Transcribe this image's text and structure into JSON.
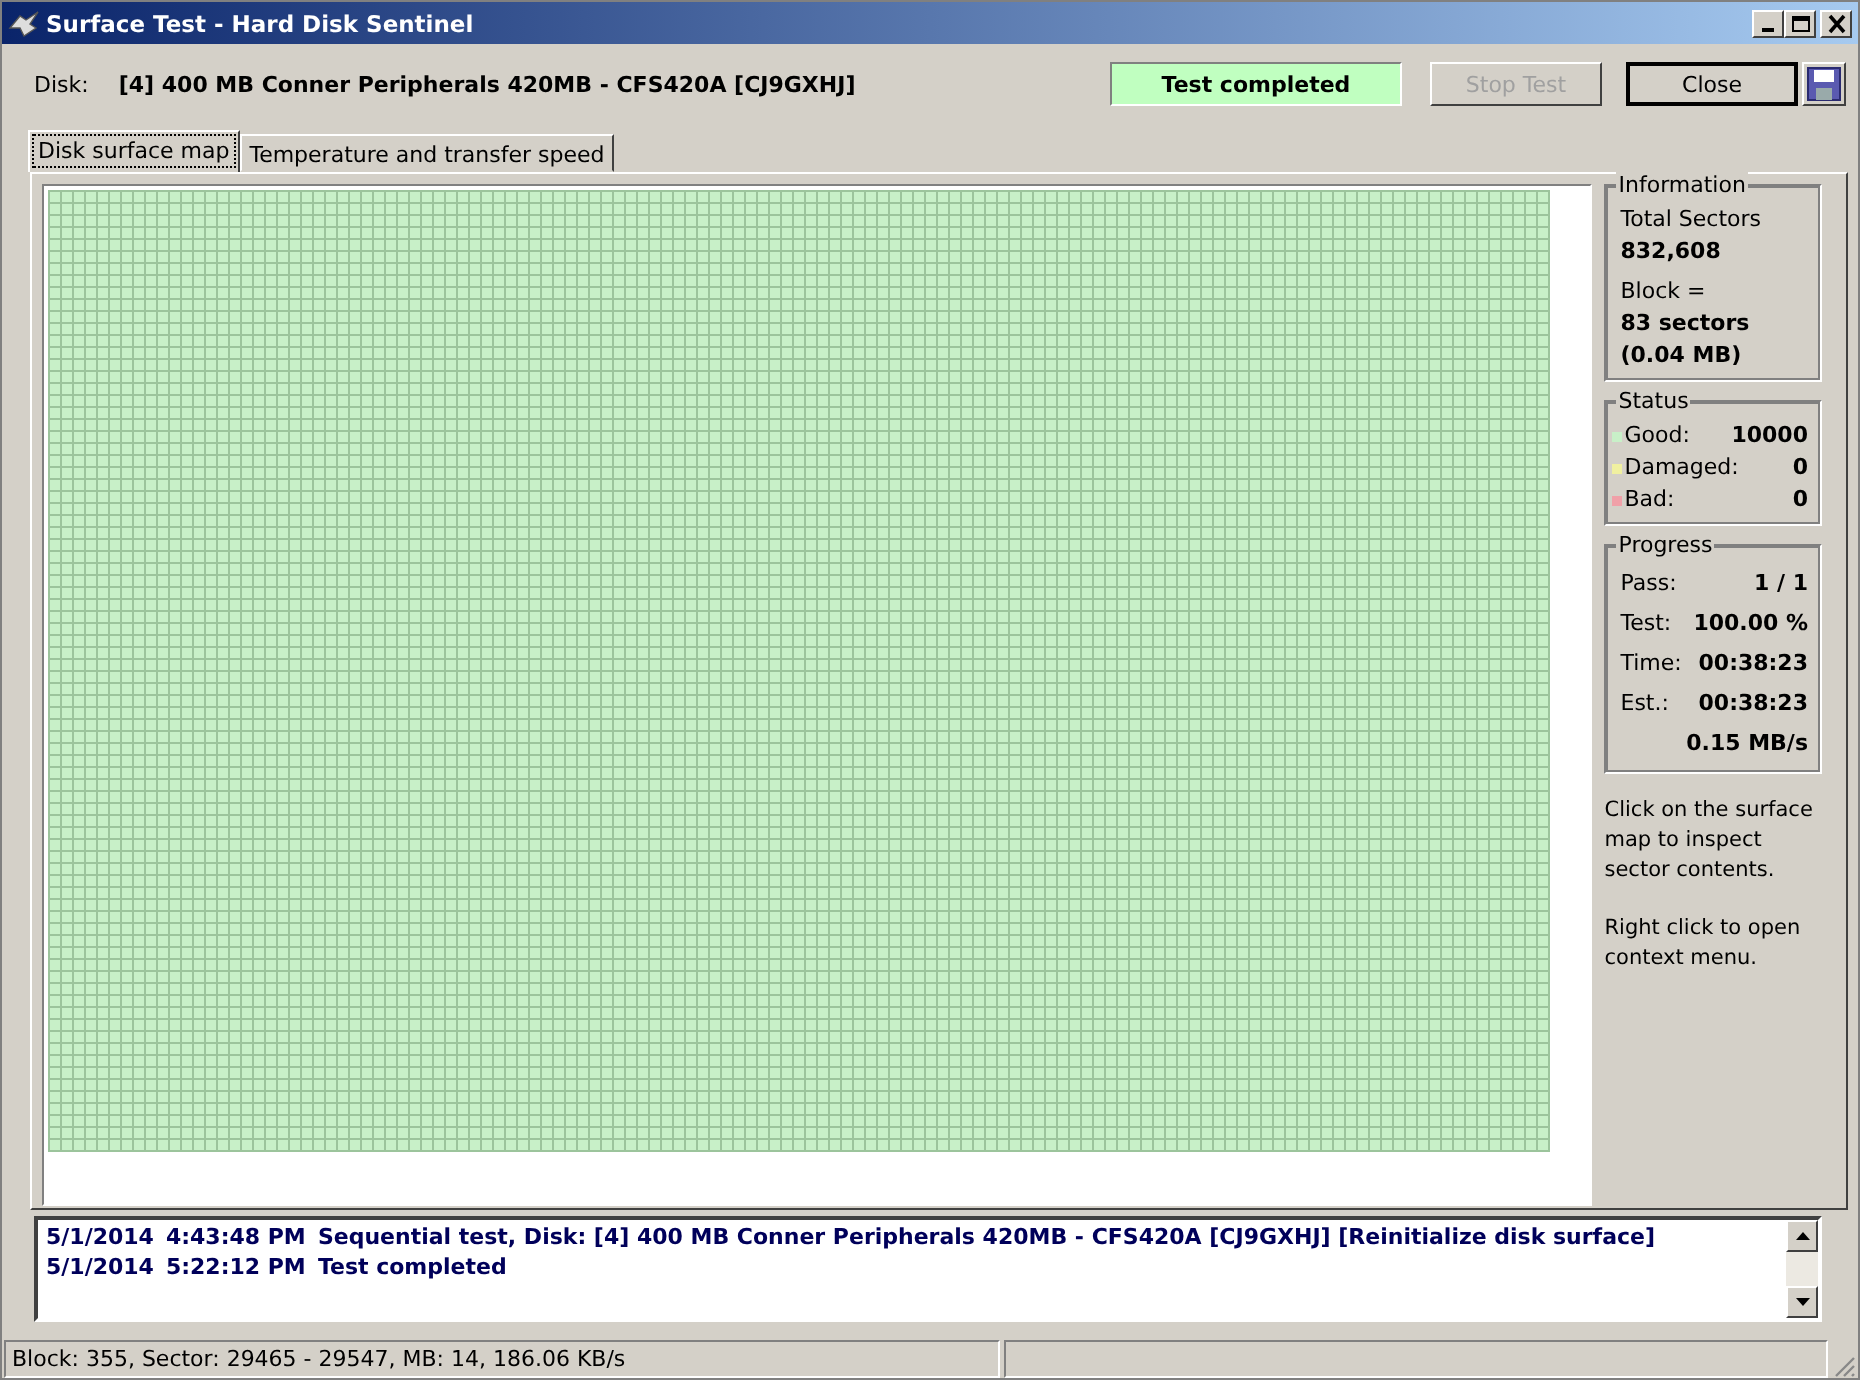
{
  "window": {
    "title": "Surface Test - Hard Disk Sentinel"
  },
  "toolbar": {
    "disk_label": "Disk:",
    "disk_name": "[4] 400 MB  Conner Peripherals 420MB - CFS420A [CJ9GXHJ]",
    "status_text": "Test completed",
    "buttons": [
      {
        "label": "Stop Test",
        "disabled": true
      },
      {
        "label": "Close",
        "disabled": false
      }
    ]
  },
  "tabs": [
    {
      "label": "Disk surface map",
      "selected": true
    },
    {
      "label": "Temperature and transfer speed",
      "selected": false
    }
  ],
  "information": {
    "title": "Information",
    "total_label": "Total Sectors",
    "total_value": "832,608",
    "block_label": "Block =",
    "block_sectors": "83 sectors",
    "block_size": "(0.04 MB)"
  },
  "status": {
    "title": "Status",
    "items": [
      {
        "label": "Good:",
        "value": "10000",
        "color": "#c8f0c8"
      },
      {
        "label": "Damaged:",
        "value": "0",
        "color": "#f0f0a0"
      },
      {
        "label": "Bad:",
        "value": "0",
        "color": "#f0a0a8"
      }
    ]
  },
  "progress": {
    "title": "Progress",
    "rows": [
      {
        "label": "Pass:",
        "value": "1 / 1"
      },
      {
        "label": "Test:",
        "value": "100.00 %"
      },
      {
        "label": "Time:",
        "value": "00:38:23"
      },
      {
        "label": "Est.:",
        "value": "00:38:23"
      },
      {
        "label": "",
        "value": "0.15 MB/s"
      }
    ]
  },
  "hints": [
    "Click on the surface map to inspect sector contents.",
    "Right click to open context menu."
  ],
  "log": [
    {
      "date": "5/1/2014",
      "time": "4:43:48 PM",
      "message": "Sequential test, Disk: [4] 400 MB  Conner Peripherals 420MB - CFS420A [CJ9GXHJ] [Reinitialize disk surface]"
    },
    {
      "date": "5/1/2014",
      "time": "5:22:12 PM",
      "message": "Test completed"
    }
  ],
  "status_bar": {
    "text": "Block: 355, Sector: 29465 - 29547, MB: 14, 186.06 KB/s"
  }
}
